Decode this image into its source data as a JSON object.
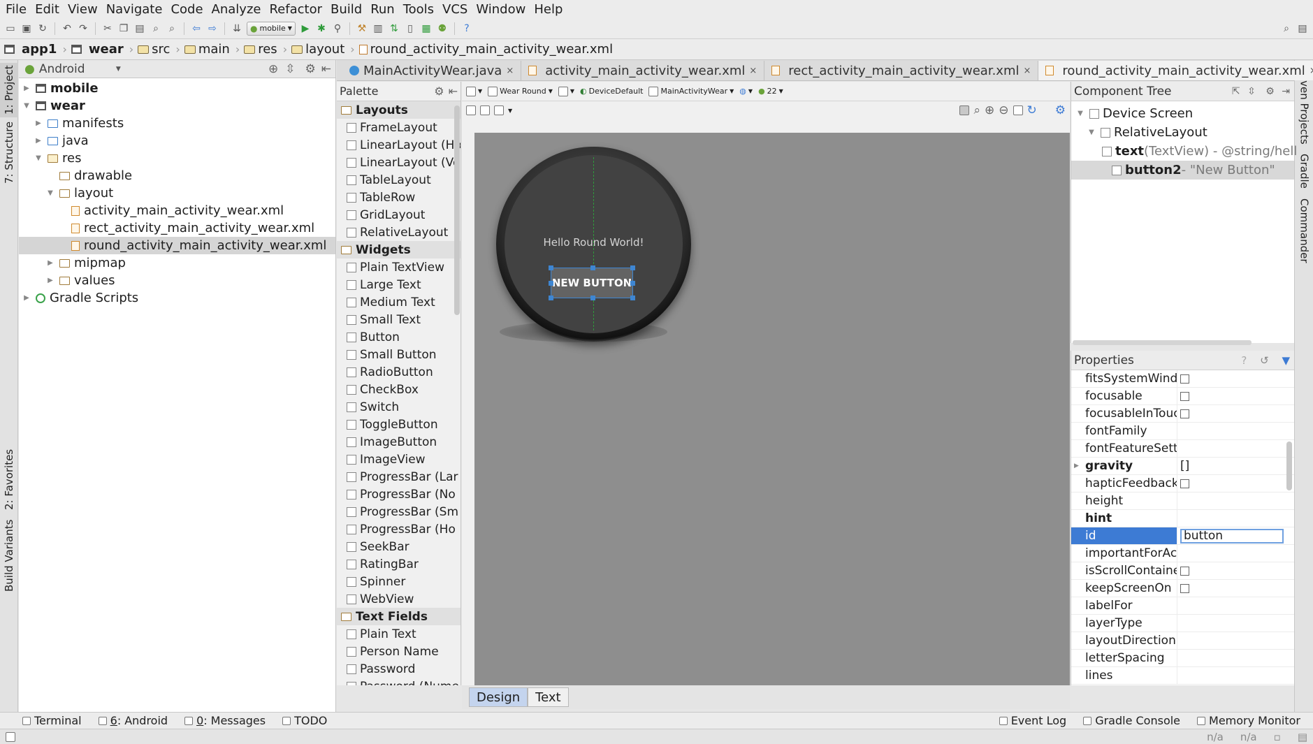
{
  "menu": [
    "File",
    "Edit",
    "View",
    "Navigate",
    "Code",
    "Analyze",
    "Refactor",
    "Build",
    "Run",
    "Tools",
    "VCS",
    "Window",
    "Help"
  ],
  "toolbar": {
    "run_config": "mobile"
  },
  "breadcrumb": [
    "app1",
    "wear",
    "src",
    "main",
    "res",
    "layout",
    "round_activity_main_activity_wear.xml"
  ],
  "left_stripe": {
    "project": "1: Project",
    "structure": "7: Structure",
    "favorites": "2: Favorites",
    "build_variants": "Build Variants"
  },
  "right_stripe": {
    "maven": "Maven Projects",
    "gradle": "Gradle",
    "commander": "Commander"
  },
  "project": {
    "view_mode": "Android",
    "tree": [
      {
        "label": "mobile",
        "depth": 0,
        "type": "module",
        "expanded": false,
        "bold": true
      },
      {
        "label": "wear",
        "depth": 0,
        "type": "module",
        "expanded": true,
        "bold": true
      },
      {
        "label": "manifests",
        "depth": 1,
        "type": "folder-blue",
        "expanded": false
      },
      {
        "label": "java",
        "depth": 1,
        "type": "folder-blue",
        "expanded": false
      },
      {
        "label": "res",
        "depth": 1,
        "type": "folder-res",
        "expanded": true
      },
      {
        "label": "drawable",
        "depth": 2,
        "type": "folder-lay",
        "expanded": null
      },
      {
        "label": "layout",
        "depth": 2,
        "type": "folder-lay",
        "expanded": true
      },
      {
        "label": "activity_main_activity_wear.xml",
        "depth": 3,
        "type": "xml"
      },
      {
        "label": "rect_activity_main_activity_wear.xml",
        "depth": 3,
        "type": "xml"
      },
      {
        "label": "round_activity_main_activity_wear.xml",
        "depth": 3,
        "type": "xml",
        "selected": true
      },
      {
        "label": "mipmap",
        "depth": 2,
        "type": "folder-lay",
        "expanded": false
      },
      {
        "label": "values",
        "depth": 2,
        "type": "folder-lay",
        "expanded": false
      },
      {
        "label": "Gradle Scripts",
        "depth": 0,
        "type": "gradle",
        "expanded": false
      }
    ]
  },
  "editor_tabs": [
    {
      "label": "MainActivityWear.java",
      "type": "java"
    },
    {
      "label": "activity_main_activity_wear.xml",
      "type": "xml"
    },
    {
      "label": "rect_activity_main_activity_wear.xml",
      "type": "xml"
    },
    {
      "label": "round_activity_main_activity_wear.xml",
      "type": "xml",
      "active": true
    }
  ],
  "palette": {
    "title": "Palette",
    "groups": [
      {
        "name": "Layouts",
        "items": [
          "FrameLayout",
          "LinearLayout (Ho",
          "LinearLayout (Ve",
          "TableLayout",
          "TableRow",
          "GridLayout",
          "RelativeLayout"
        ]
      },
      {
        "name": "Widgets",
        "items": [
          "Plain TextView",
          "Large Text",
          "Medium Text",
          "Small Text",
          "Button",
          "Small Button",
          "RadioButton",
          "CheckBox",
          "Switch",
          "ToggleButton",
          "ImageButton",
          "ImageView",
          "ProgressBar (Lar",
          "ProgressBar (No",
          "ProgressBar (Sm",
          "ProgressBar (Ho",
          "SeekBar",
          "RatingBar",
          "Spinner",
          "WebView"
        ]
      },
      {
        "name": "Text Fields",
        "items": [
          "Plain Text",
          "Person Name",
          "Password",
          "Password (Nume"
        ]
      }
    ]
  },
  "designer": {
    "device": "Wear Round",
    "theme": "DeviceDefault",
    "activity": "MainActivityWear",
    "api": "22",
    "hello_text": "Hello Round World!",
    "button_text": "NEW BUTTON"
  },
  "design_tabs": [
    "Design",
    "Text"
  ],
  "component_tree": {
    "title": "Component Tree",
    "rows": [
      {
        "label": "Device Screen",
        "extra": "",
        "depth": 0
      },
      {
        "label": "RelativeLayout",
        "extra": "",
        "depth": 1
      },
      {
        "label": "text",
        "extra": " (TextView) - @string/hell",
        "depth": 2,
        "bold": true
      },
      {
        "label": "button2",
        "extra": " - \"New Button\"",
        "depth": 2,
        "bold": true,
        "selected": true
      }
    ]
  },
  "properties": {
    "title": "Properties",
    "rows": [
      {
        "name": "fitsSystemWindc",
        "value": "",
        "checkbox": true
      },
      {
        "name": "focusable",
        "value": "",
        "checkbox": true
      },
      {
        "name": "focusableInTouc",
        "value": "",
        "checkbox": true
      },
      {
        "name": "fontFamily",
        "value": ""
      },
      {
        "name": "fontFeatureSett",
        "value": ""
      },
      {
        "name": "gravity",
        "value": "[]",
        "bold": true,
        "expandable": true
      },
      {
        "name": "hapticFeedbackI",
        "value": "",
        "checkbox": true
      },
      {
        "name": "height",
        "value": ""
      },
      {
        "name": "hint",
        "value": "",
        "bold": true
      },
      {
        "name": "id",
        "value": "button",
        "selected": true,
        "editing": true
      },
      {
        "name": "importantForAc",
        "value": ""
      },
      {
        "name": "isScrollContainer",
        "value": "",
        "checkbox": true
      },
      {
        "name": "keepScreenOn",
        "value": "",
        "checkbox": true
      },
      {
        "name": "labelFor",
        "value": ""
      },
      {
        "name": "layerType",
        "value": ""
      },
      {
        "name": "layoutDirection",
        "value": ""
      },
      {
        "name": "letterSpacing",
        "value": ""
      },
      {
        "name": "lines",
        "value": ""
      }
    ]
  },
  "bottom_tools_left": [
    {
      "label": "Terminal",
      "mnemonic": ""
    },
    {
      "label": "Android",
      "mnemonic": "6"
    },
    {
      "label": "Messages",
      "mnemonic": "0"
    },
    {
      "label": "TODO",
      "mnemonic": ""
    }
  ],
  "bottom_tools_right": [
    "Event Log",
    "Gradle Console",
    "Memory Monitor"
  ],
  "status": {
    "pos1": "n/a",
    "pos2": "n/a"
  }
}
